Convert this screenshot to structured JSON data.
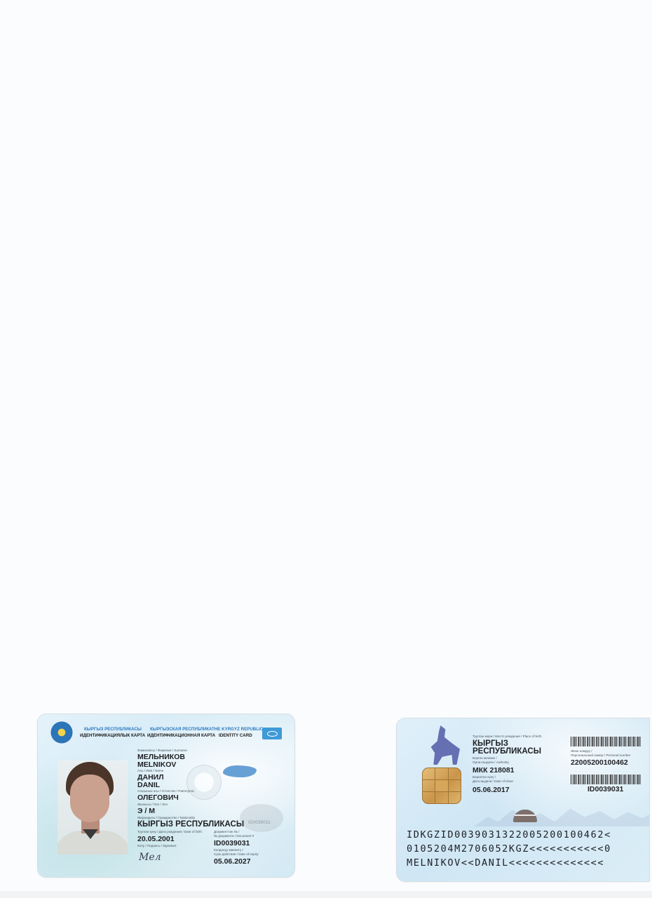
{
  "front": {
    "header": {
      "top_ky": "КЫРГЫЗ РЕСПУБЛИКАСЫ",
      "top_ru": "КЫРГЫЗСКАЯ РЕСПУБЛИКА",
      "top_en": "THE KYRGYZ REPUBLIC",
      "bot_ky": "ИДЕНТИФИКАЦИЯЛЫК КАРТА",
      "bot_ru": "ИДЕНТИФИКАЦИОННАЯ КАРТА",
      "bot_en": "IDENTITY CARD"
    },
    "surname_label": "Фамилиясы / Фамилия / Surname",
    "surname_cyr": "МЕЛЬНИКОВ",
    "surname_lat": "MELNIKOV",
    "name_label": "Аты / Имя / Name",
    "name_cyr": "ДАНИЛ",
    "name_lat": "DANIL",
    "patronymic_label": "Атасынын аты / Отчество / Patronymic",
    "patronymic": "ОЛЕГОВИЧ",
    "sex_label": "Жынысы / Пол / Sex",
    "sex": "Э / М",
    "nationality_label": "Жарандыгы / Гражданство / Nationality",
    "nationality": "КЫРГЫЗ РЕСПУБЛИКАСЫ",
    "dob_label": "Туулган күнү / Дата рождения / Date of birth",
    "dob": "20.05.2001",
    "signature_label": "Колу / Подпись / Signature",
    "signature": "Мел",
    "docnum_label_1": "Документтин № /",
    "docnum_label_2": "№ документа / Document #",
    "docnum": "ID0039031",
    "expiry_label_1": "Колдонуу мөөнөтү /",
    "expiry_label_2": "Срок действия / Date of expiry",
    "expiry": "05.06.2027",
    "ghost_number": "ID0039031"
  },
  "back": {
    "place_label": "Туулган жери / Место рождения / Place of birth",
    "place_1": "КЫРГЫЗ",
    "place_2": "РЕСПУБЛИКАСЫ",
    "authority_label_1": "Берген мекеме /",
    "authority_label_2": "Орган выдачи / Authority",
    "authority": "МКК 218081",
    "issue_label_1": "Берилген күнү /",
    "issue_label_2": "Дата выдачи / Date of issue",
    "issue_date": "05.06.2017",
    "pin_label_1": "Жеке номуру /",
    "pin_label_2": "Персональный номер / Personal number",
    "pin": "22005200100462",
    "docnum": "ID0039031",
    "mrz": [
      "IDKGZID0039031322005200100462<",
      "0105204M2706052KGZ<<<<<<<<<<<0",
      "MELNIKOV<<DANIL<<<<<<<<<<<<<<"
    ]
  }
}
